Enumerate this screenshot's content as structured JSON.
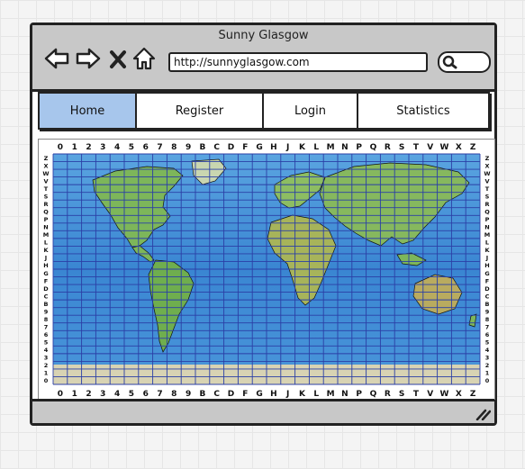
{
  "window": {
    "title": "Sunny Glasgow"
  },
  "browser": {
    "url": "http://sunnyglasgow.com",
    "icons": [
      "back-arrow-icon",
      "forward-arrow-icon",
      "close-icon",
      "home-icon",
      "search-icon"
    ]
  },
  "nav": {
    "tabs": [
      {
        "label": "Home",
        "active": true
      },
      {
        "label": "Register",
        "active": false
      },
      {
        "label": "Login",
        "active": false
      },
      {
        "label": "Statistics",
        "active": false
      }
    ]
  },
  "map": {
    "column_labels": [
      "0",
      "1",
      "2",
      "3",
      "4",
      "5",
      "6",
      "7",
      "8",
      "9",
      "B",
      "C",
      "D",
      "F",
      "G",
      "H",
      "J",
      "K",
      "L",
      "M",
      "N",
      "P",
      "Q",
      "R",
      "S",
      "T",
      "V",
      "W",
      "X",
      "Z"
    ],
    "row_labels": [
      "Z",
      "X",
      "W",
      "V",
      "T",
      "S",
      "R",
      "Q",
      "P",
      "N",
      "M",
      "L",
      "K",
      "J",
      "H",
      "G",
      "F",
      "D",
      "C",
      "B",
      "9",
      "8",
      "7",
      "6",
      "5",
      "4",
      "3",
      "2",
      "1",
      "0"
    ],
    "colors": {
      "ocean": "#3f8fd6",
      "land": "#7db65a",
      "ice": "#d8d3b3",
      "grid": "#2b3fa6",
      "borders": "#111111"
    }
  }
}
